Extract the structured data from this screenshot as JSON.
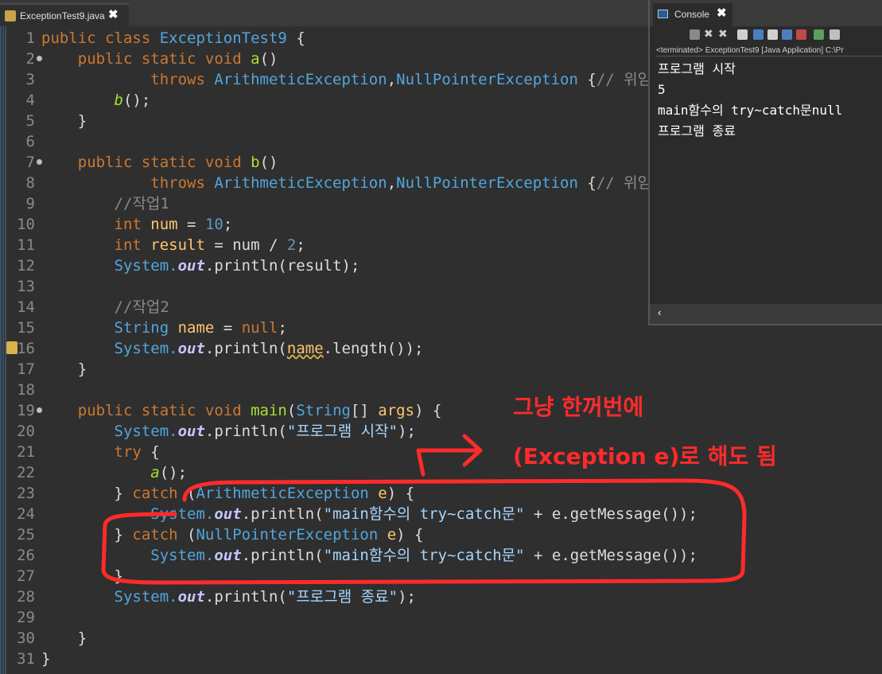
{
  "editor_tab": {
    "title": "ExceptionTest9.java",
    "close": "✖"
  },
  "console": {
    "tab_label": "Console",
    "close": "✖",
    "status": "<terminated> ExceptionTest9 [Java Application] C:\\Pr",
    "output": [
      "프로그램 시작",
      "5",
      "main함수의 try~catch문null",
      "프로그램 종료"
    ],
    "scroll_left": "‹"
  },
  "code": {
    "l1": {
      "n": "1",
      "a": "public class ",
      "b": "ExceptionTest9",
      "c": " {"
    },
    "l2": {
      "n": "2",
      "a": "    public static void ",
      "b": "a",
      "c": "()"
    },
    "l3": {
      "n": "3",
      "a": "            throws ",
      "b": "ArithmeticException",
      "c": ",",
      "d": "NullPointerException",
      "e": " {",
      "f": "// 위임"
    },
    "l4": {
      "n": "4",
      "a": "        ",
      "b": "b",
      "c": "();"
    },
    "l5": {
      "n": "5",
      "a": "    }"
    },
    "l6": {
      "n": "6"
    },
    "l7": {
      "n": "7",
      "a": "    public static void ",
      "b": "b",
      "c": "()"
    },
    "l8": {
      "n": "8",
      "a": "            throws ",
      "b": "ArithmeticException",
      "c": ",",
      "d": "NullPointerException",
      "e": " {",
      "f": "// 위임"
    },
    "l9": {
      "n": "9",
      "a": "        ",
      "b": "//작업1"
    },
    "l10": {
      "n": "10",
      "a": "        ",
      "b": "int ",
      "c": "num",
      "d": " = ",
      "e": "10",
      "f": ";"
    },
    "l11": {
      "n": "11",
      "a": "        ",
      "b": "int ",
      "c": "result",
      "d": " = num / ",
      "e": "2",
      "f": ";"
    },
    "l12": {
      "n": "12",
      "a": "        ",
      "b": "System.",
      "c": "out",
      "d": ".println(result);"
    },
    "l13": {
      "n": "13"
    },
    "l14": {
      "n": "14",
      "a": "        ",
      "b": "//작업2"
    },
    "l15": {
      "n": "15",
      "a": "        ",
      "b": "String ",
      "c": "name",
      "d": " = ",
      "e": "null",
      "f": ";"
    },
    "l16": {
      "n": "16",
      "a": "        ",
      "b": "System.",
      "c": "out",
      "d": ".println(",
      "e": "name",
      "f": ".length());"
    },
    "l17": {
      "n": "17",
      "a": "    }"
    },
    "l18": {
      "n": "18"
    },
    "l19": {
      "n": "19",
      "a": "    public static void ",
      "b": "main",
      "c": "(",
      "d": "String",
      "e": "[] ",
      "f": "args",
      "g": ") {"
    },
    "l20": {
      "n": "20",
      "a": "        ",
      "b": "System.",
      "c": "out",
      "d": ".println(",
      "e": "\"프로그램 시작\"",
      "f": ");"
    },
    "l21": {
      "n": "21",
      "a": "        ",
      "b": "try",
      "c": " {"
    },
    "l22": {
      "n": "22",
      "a": "            ",
      "b": "a",
      "c": "();"
    },
    "l23": {
      "n": "23",
      "a": "        } ",
      "b": "catch",
      "c": " (",
      "d": "ArithmeticException",
      "e": " e",
      "f": ") {"
    },
    "l24": {
      "n": "24",
      "a": "            ",
      "b": "System.",
      "c": "out",
      "d": ".println(",
      "e": "\"main함수의 try~catch문\"",
      "f": " + e.getMessage());"
    },
    "l25": {
      "n": "25",
      "a": "        } ",
      "b": "catch",
      "c": " (",
      "d": "NullPointerException",
      "e": " e",
      "f": ") {"
    },
    "l26": {
      "n": "26",
      "a": "            ",
      "b": "System.",
      "c": "out",
      "d": ".println(",
      "e": "\"main함수의 try~catch문\"",
      "f": " + e.getMessage());"
    },
    "l27": {
      "n": "27",
      "a": "        }"
    },
    "l28": {
      "n": "28",
      "a": "        ",
      "b": "System.",
      "c": "out",
      "d": ".println(",
      "e": "\"프로그램 종료\"",
      "f": ");"
    },
    "l29": {
      "n": "29"
    },
    "l30": {
      "n": "30",
      "a": "    }"
    },
    "l31": {
      "n": "31",
      "a": "}"
    }
  },
  "annotation": {
    "line1": "그냥 한꺼번에",
    "line2": "(Exception e)로 해도 됨",
    "color": "#ff2b2b"
  }
}
